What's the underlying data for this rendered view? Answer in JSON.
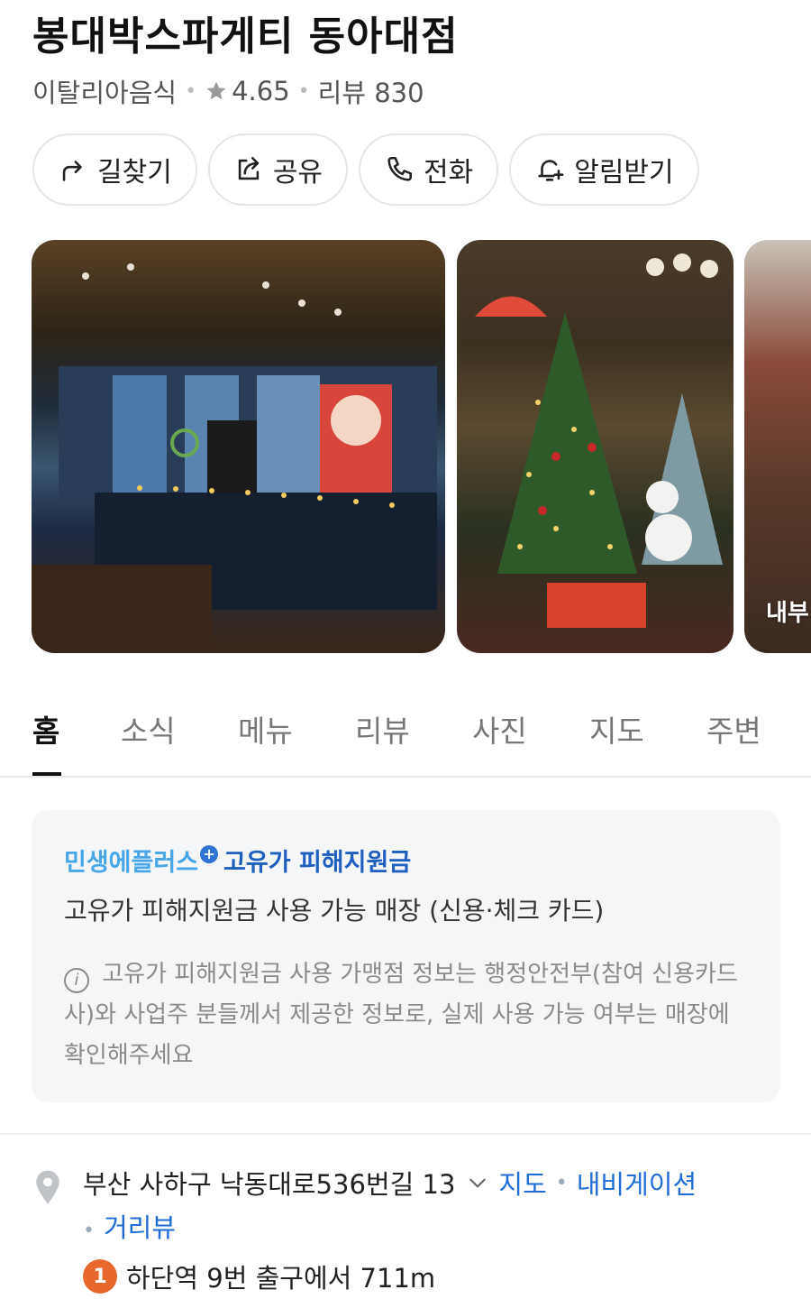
{
  "place": {
    "name": "봉대박스파게티 동아대점",
    "category": "이탈리아음식",
    "rating": "4.65",
    "review_count": "리뷰 830"
  },
  "actions": [
    {
      "label": "길찾기",
      "icon": "directions-icon"
    },
    {
      "label": "공유",
      "icon": "share-icon"
    },
    {
      "label": "전화",
      "icon": "phone-icon"
    },
    {
      "label": "알림받기",
      "icon": "bell-plus-icon"
    }
  ],
  "photos": {
    "third_badge": "내부"
  },
  "tabs": [
    "홈",
    "소식",
    "메뉴",
    "리뷰",
    "사진",
    "지도",
    "주변"
  ],
  "active_tab": "홈",
  "notice": {
    "brand_left": "민생에플러스",
    "brand_right": "고유가 피해지원금",
    "main": "고유가 피해지원금 사용 가능 매장 (신용·체크 카드)",
    "info": "고유가 피해지원금 사용 가맹점 정보는 행정안전부(참여 신용카드사)와 사업주 분들께서 제공한 정보로, 실제 사용 가능 여부는 매장에 확인해주세요"
  },
  "address": {
    "text": "부산 사하구 낙동대로536번길 13",
    "links": [
      "지도",
      "내비게이션",
      "거리뷰"
    ],
    "station_line": "1",
    "station_text": "하단역 9번 출구에서 711m"
  },
  "colors": {
    "link": "#1f6dd6",
    "line1": "#e8672d",
    "brand_light": "#47a6e8",
    "brand_dark": "#1f5fc0"
  }
}
